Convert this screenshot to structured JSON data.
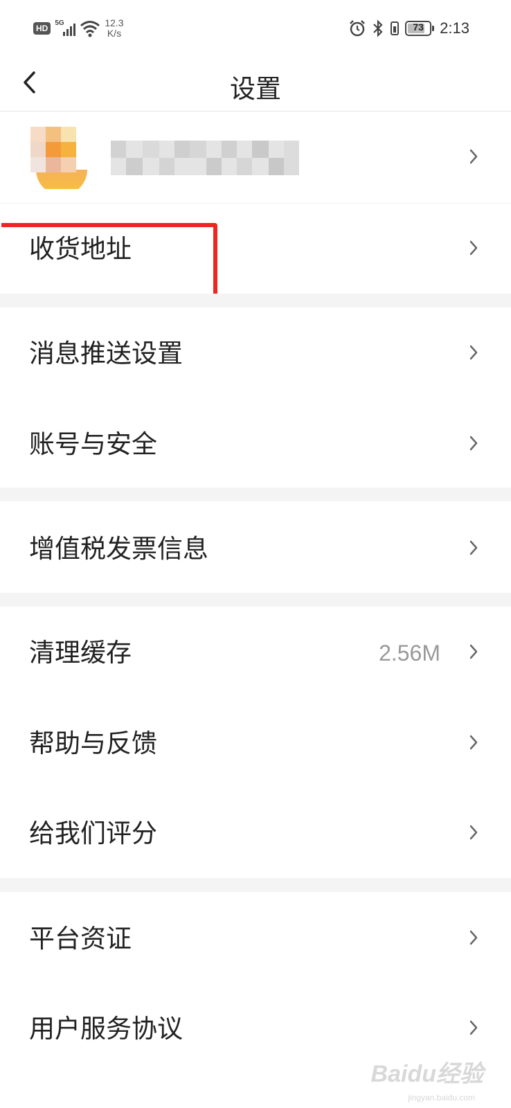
{
  "status_bar": {
    "hd": "HD",
    "network": "5G",
    "speed_value": "12.3",
    "speed_unit": "K/s",
    "battery": "73",
    "time": "2:13"
  },
  "header": {
    "title": "设置"
  },
  "menu": {
    "address": {
      "label": "收货地址"
    },
    "push": {
      "label": "消息推送设置"
    },
    "account": {
      "label": "账号与安全"
    },
    "invoice": {
      "label": "增值税发票信息"
    },
    "cache": {
      "label": "清理缓存",
      "value": "2.56M"
    },
    "help": {
      "label": "帮助与反馈"
    },
    "rate": {
      "label": "给我们评分"
    },
    "cert": {
      "label": "平台资证"
    },
    "agreement": {
      "label": "用户服务协议"
    }
  },
  "watermark": {
    "brand": "Baidu经验",
    "url": "jingyan.baidu.com"
  },
  "colors": {
    "highlight": "#f02522",
    "separator": "#f4f4f4",
    "avatar_accent": "#f7a630"
  }
}
